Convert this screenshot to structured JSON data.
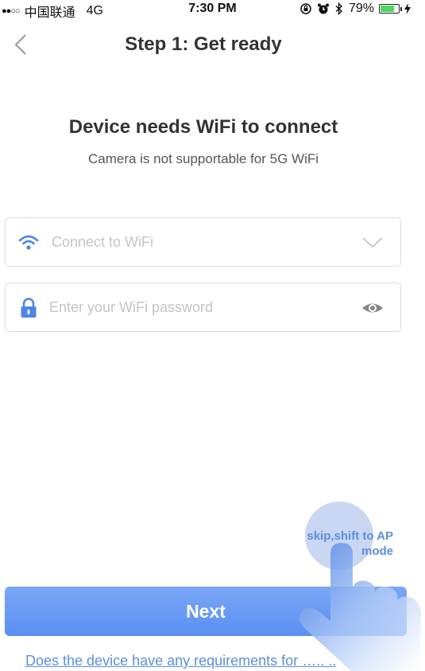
{
  "status_bar": {
    "signal": "●●○○",
    "carrier": "中国联通",
    "network": "4G",
    "time": "7:30 PM",
    "icons": [
      "rotation-lock-icon",
      "alarm-icon",
      "bluetooth-icon"
    ],
    "battery": "79%",
    "battery_level": 0.79
  },
  "nav": {
    "back_icon": "chevron-left-icon",
    "title": "Step 1: Get ready"
  },
  "main": {
    "heading": "Device needs WiFi to connect",
    "subheading": "Camera is not supportable for 5G WiFi",
    "wifi_field": {
      "icon": "wifi-icon",
      "placeholder": "Connect to WiFi",
      "trailing_icon": "chevron-down-icon"
    },
    "password_field": {
      "icon": "lock-icon",
      "placeholder": "Enter your WiFi password",
      "trailing_icon": "eye-icon"
    },
    "skip_link": "skip,shift to AP mode",
    "next_label": "Next",
    "requirements_link": "Does the device have any requirements for ….. .."
  },
  "colors": {
    "accent": "#5a8fe0",
    "button": "#6a9af4",
    "placeholder": "#c4c4c4"
  }
}
